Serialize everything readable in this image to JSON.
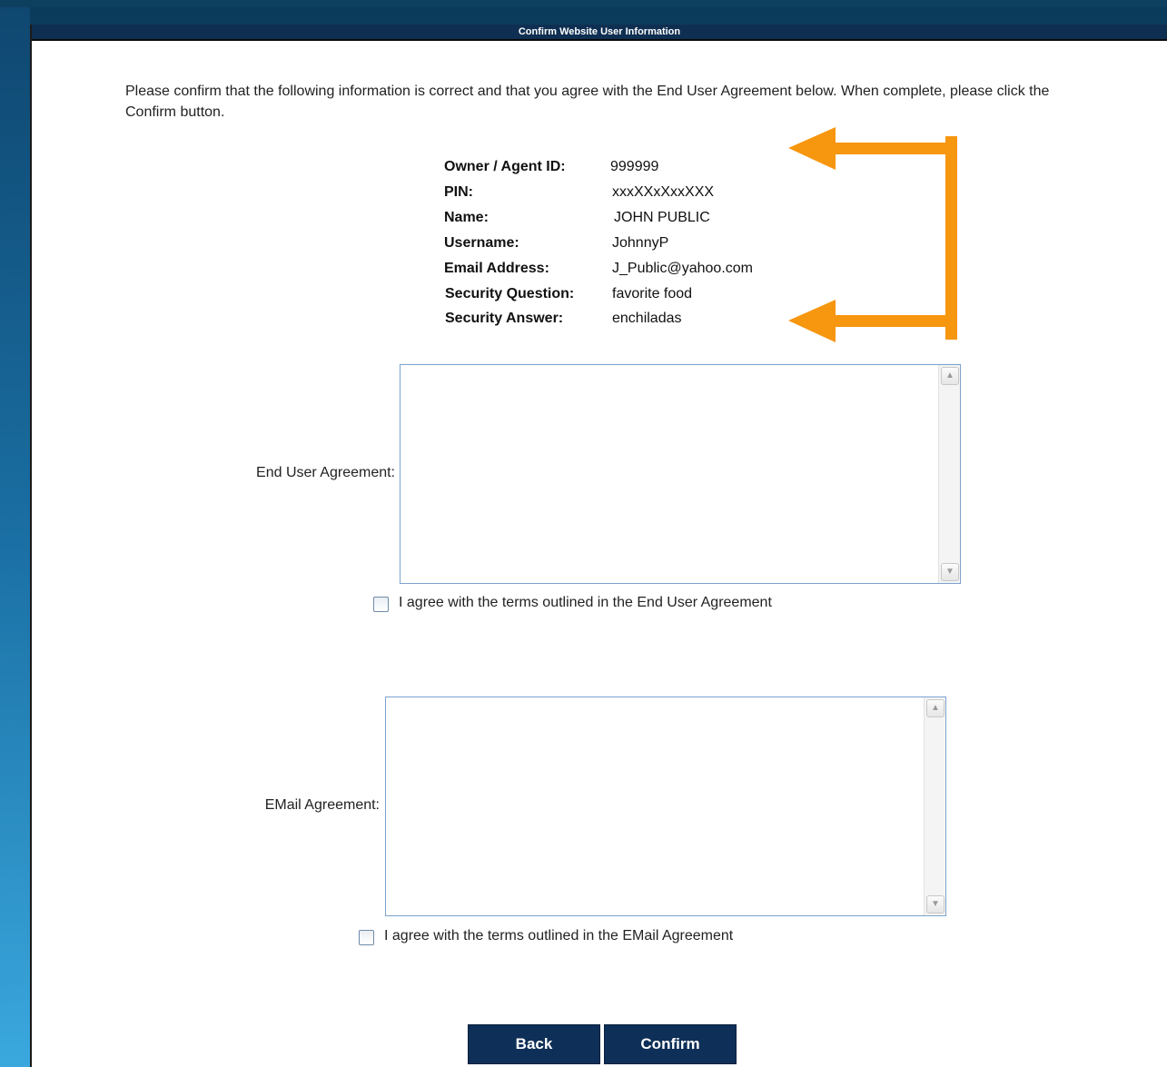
{
  "window": {
    "title": "Confirm Website User Information"
  },
  "intro": "Please confirm that the following information is correct and that you agree with the End User Agreement below. When complete, please click the Confirm button.",
  "info": [
    {
      "label": "Owner / Agent ID:",
      "value": "999999"
    },
    {
      "label": "PIN:",
      "value": "xxxXXxXxxXXX"
    },
    {
      "label": "Name:",
      "value": "JOHN PUBLIC"
    },
    {
      "label": "Username:",
      "value": "JohnnyP"
    },
    {
      "label": "Email Address:",
      "value": "J_Public@yahoo.com"
    },
    {
      "label": "Security Question:",
      "value": "favorite food"
    },
    {
      "label": "Security Answer:",
      "value": "enchiladas"
    }
  ],
  "agreements": {
    "end_user": {
      "label": "End User Agreement:",
      "text": "",
      "checkbox_label": "I agree with the terms outlined in the End User Agreement",
      "checked": false
    },
    "email": {
      "label": "EMail Agreement:",
      "text": "",
      "checkbox_label": "I agree with the terms outlined in the EMail Agreement",
      "checked": false
    }
  },
  "buttons": {
    "back": "Back",
    "confirm": "Confirm"
  },
  "colors": {
    "header_bg": "#0f2f52",
    "button_bg": "#0e2f57",
    "annotation_arrow": "#f7960f",
    "textbox_border": "#7da2ce"
  },
  "icons": {
    "scroll_up": "scroll-up-arrow-icon",
    "scroll_down": "scroll-down-arrow-icon",
    "annotation": "orange-bracket-arrow-icon"
  }
}
